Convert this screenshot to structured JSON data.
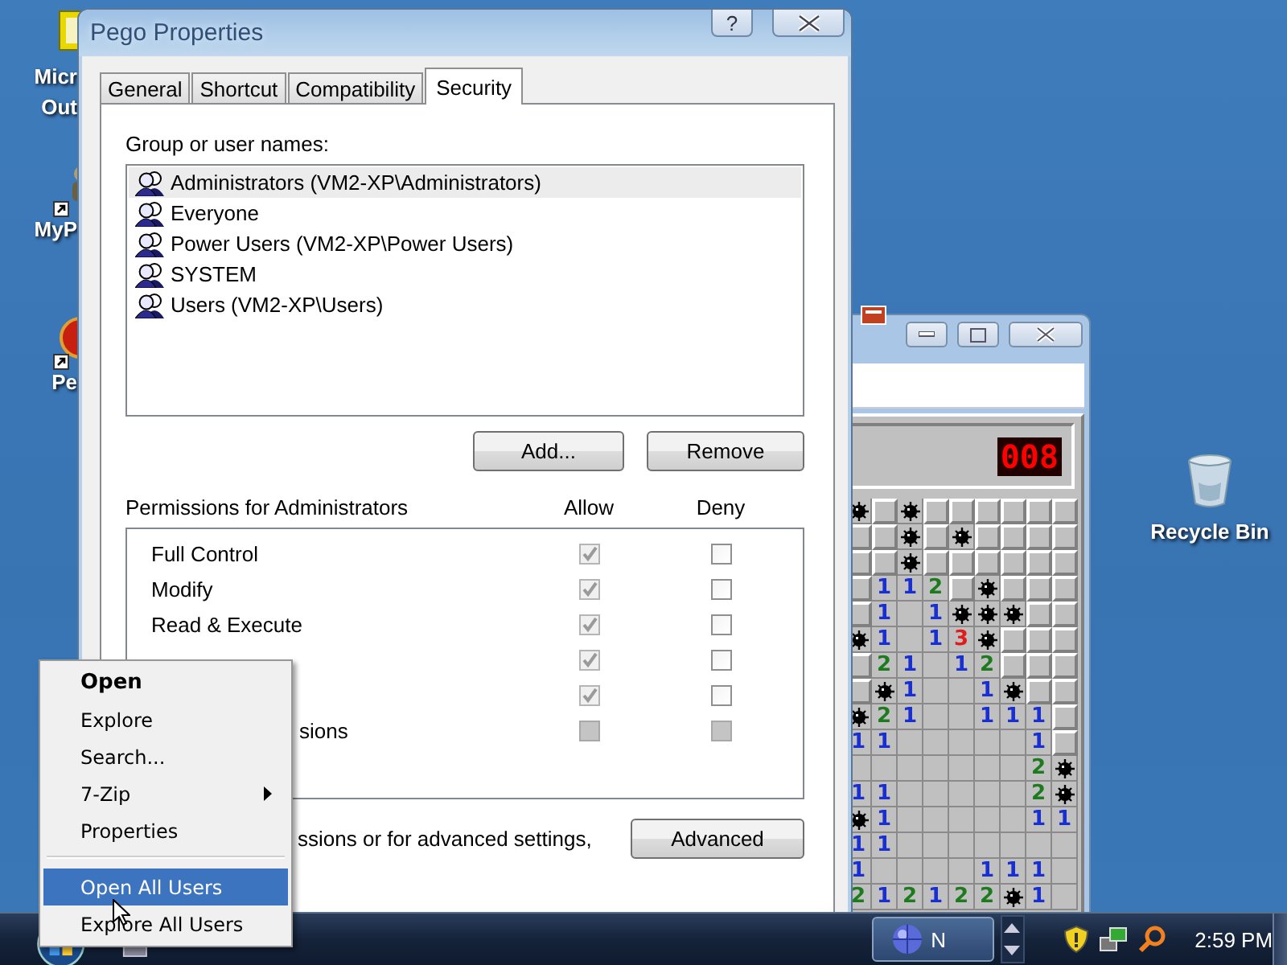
{
  "desktop_icons": [
    {
      "lines": [
        "Micr",
        "Out"
      ],
      "kind": "square",
      "shortcut": false
    },
    {
      "lines": [
        "MyP"
      ],
      "kind": "figure",
      "shortcut": true
    },
    {
      "lines": [
        "Pe"
      ],
      "kind": "ball",
      "shortcut": true
    }
  ],
  "recycle_bin": {
    "label": "Recycle Bin"
  },
  "minesweeper": {
    "counter": "008",
    "rows": [
      [
        {
          "kind": "mine"
        },
        {
          "kind": "hidden"
        },
        {
          "kind": "mine"
        },
        {
          "kind": "hidden"
        },
        {
          "kind": "hidden"
        },
        {
          "kind": "hidden"
        },
        {
          "kind": "hidden"
        },
        {
          "kind": "hidden"
        },
        {
          "kind": "hidden"
        }
      ],
      [
        {
          "kind": "hidden"
        },
        {
          "kind": "hidden"
        },
        {
          "kind": "mine"
        },
        {
          "kind": "hidden"
        },
        {
          "kind": "mine"
        },
        {
          "kind": "hidden"
        },
        {
          "kind": "hidden"
        },
        {
          "kind": "hidden"
        },
        {
          "kind": "hidden"
        }
      ],
      [
        {
          "kind": "hidden"
        },
        {
          "kind": "hidden"
        },
        {
          "kind": "mine"
        },
        {
          "kind": "hidden"
        },
        {
          "kind": "hidden"
        },
        {
          "kind": "hidden"
        },
        {
          "kind": "hidden"
        },
        {
          "kind": "hidden"
        },
        {
          "kind": "hidden"
        }
      ],
      [
        {
          "kind": "hidden"
        },
        {
          "kind": "number",
          "value": "1"
        },
        {
          "kind": "number",
          "value": "1"
        },
        {
          "kind": "number",
          "value": "2"
        },
        {
          "kind": "hidden"
        },
        {
          "kind": "mine"
        },
        {
          "kind": "hidden"
        },
        {
          "kind": "hidden"
        },
        {
          "kind": "hidden"
        }
      ],
      [
        {
          "kind": "hidden"
        },
        {
          "kind": "number",
          "value": "1"
        },
        {
          "kind": "open"
        },
        {
          "kind": "number",
          "value": "1"
        },
        {
          "kind": "mine"
        },
        {
          "kind": "mine"
        },
        {
          "kind": "mine"
        },
        {
          "kind": "hidden"
        },
        {
          "kind": "hidden"
        }
      ],
      [
        {
          "kind": "mine"
        },
        {
          "kind": "number",
          "value": "1"
        },
        {
          "kind": "open"
        },
        {
          "kind": "number",
          "value": "1"
        },
        {
          "kind": "number",
          "value": "3"
        },
        {
          "kind": "mine"
        },
        {
          "kind": "hidden"
        },
        {
          "kind": "hidden"
        },
        {
          "kind": "hidden"
        }
      ],
      [
        {
          "kind": "hidden"
        },
        {
          "kind": "number",
          "value": "2"
        },
        {
          "kind": "number",
          "value": "1"
        },
        {
          "kind": "open"
        },
        {
          "kind": "number",
          "value": "1"
        },
        {
          "kind": "number",
          "value": "2"
        },
        {
          "kind": "hidden"
        },
        {
          "kind": "hidden"
        },
        {
          "kind": "hidden"
        }
      ],
      [
        {
          "kind": "hidden"
        },
        {
          "kind": "mine"
        },
        {
          "kind": "number",
          "value": "1"
        },
        {
          "kind": "open"
        },
        {
          "kind": "open"
        },
        {
          "kind": "number",
          "value": "1"
        },
        {
          "kind": "mine"
        },
        {
          "kind": "hidden"
        },
        {
          "kind": "hidden"
        }
      ],
      [
        {
          "kind": "mine"
        },
        {
          "kind": "number",
          "value": "2"
        },
        {
          "kind": "number",
          "value": "1"
        },
        {
          "kind": "open"
        },
        {
          "kind": "open"
        },
        {
          "kind": "number",
          "value": "1"
        },
        {
          "kind": "number",
          "value": "1"
        },
        {
          "kind": "number",
          "value": "1"
        },
        {
          "kind": "hidden"
        }
      ],
      [
        {
          "kind": "number",
          "value": "1"
        },
        {
          "kind": "number",
          "value": "1"
        },
        {
          "kind": "open"
        },
        {
          "kind": "open"
        },
        {
          "kind": "open"
        },
        {
          "kind": "open"
        },
        {
          "kind": "open"
        },
        {
          "kind": "number",
          "value": "1"
        },
        {
          "kind": "hidden"
        }
      ],
      [
        {
          "kind": "open"
        },
        {
          "kind": "open"
        },
        {
          "kind": "open"
        },
        {
          "kind": "open"
        },
        {
          "kind": "open"
        },
        {
          "kind": "open"
        },
        {
          "kind": "open"
        },
        {
          "kind": "number",
          "value": "2"
        },
        {
          "kind": "mine"
        }
      ],
      [
        {
          "kind": "number",
          "value": "1"
        },
        {
          "kind": "number",
          "value": "1"
        },
        {
          "kind": "open"
        },
        {
          "kind": "open"
        },
        {
          "kind": "open"
        },
        {
          "kind": "open"
        },
        {
          "kind": "open"
        },
        {
          "kind": "number",
          "value": "2"
        },
        {
          "kind": "mine"
        }
      ],
      [
        {
          "kind": "mine"
        },
        {
          "kind": "number",
          "value": "1"
        },
        {
          "kind": "open"
        },
        {
          "kind": "open"
        },
        {
          "kind": "open"
        },
        {
          "kind": "open"
        },
        {
          "kind": "open"
        },
        {
          "kind": "number",
          "value": "1"
        },
        {
          "kind": "number",
          "value": "1"
        }
      ],
      [
        {
          "kind": "number",
          "value": "1"
        },
        {
          "kind": "number",
          "value": "1"
        },
        {
          "kind": "open"
        },
        {
          "kind": "open"
        },
        {
          "kind": "open"
        },
        {
          "kind": "open"
        },
        {
          "kind": "open"
        },
        {
          "kind": "open"
        },
        {
          "kind": "open"
        }
      ],
      [
        {
          "kind": "number",
          "value": "1"
        },
        {
          "kind": "open"
        },
        {
          "kind": "open"
        },
        {
          "kind": "open"
        },
        {
          "kind": "open"
        },
        {
          "kind": "number",
          "value": "1"
        },
        {
          "kind": "number",
          "value": "1"
        },
        {
          "kind": "number",
          "value": "1"
        },
        {
          "kind": "open"
        }
      ],
      [
        {
          "kind": "number",
          "value": "2"
        },
        {
          "kind": "number",
          "value": "1"
        },
        {
          "kind": "number",
          "value": "2"
        },
        {
          "kind": "number",
          "value": "1"
        },
        {
          "kind": "number",
          "value": "2"
        },
        {
          "kind": "number",
          "value": "2"
        },
        {
          "kind": "mine"
        },
        {
          "kind": "number",
          "value": "1"
        },
        {
          "kind": "open"
        }
      ]
    ]
  },
  "dialog": {
    "title": "Pego Properties",
    "help": "?",
    "tabs": [
      {
        "label": "General",
        "selected": false
      },
      {
        "label": "Shortcut",
        "selected": false
      },
      {
        "label": "Compatibility",
        "selected": false
      },
      {
        "label": "Security",
        "selected": true
      }
    ],
    "group_label": "Group or user names:",
    "users": [
      {
        "name": "Administrators (VM2-XP\\Administrators)",
        "selected": true
      },
      {
        "name": "Everyone",
        "selected": false
      },
      {
        "name": "Power Users (VM2-XP\\Power Users)",
        "selected": false
      },
      {
        "name": "SYSTEM",
        "selected": false
      },
      {
        "name": "Users (VM2-XP\\Users)",
        "selected": false
      }
    ],
    "buttons": [
      "Add...",
      "Remove"
    ],
    "permissions_label": "Permissions for Administrators",
    "columns": [
      "Allow",
      "Deny"
    ],
    "permissions": [
      {
        "label": "Full Control",
        "partial": false,
        "allow": {
          "checked": true,
          "disabled": true
        },
        "deny": {
          "checked": false,
          "disabled": false
        }
      },
      {
        "label": "Modify",
        "partial": false,
        "allow": {
          "checked": true,
          "disabled": true
        },
        "deny": {
          "checked": false,
          "disabled": false
        }
      },
      {
        "label": "Read & Execute",
        "partial": false,
        "allow": {
          "checked": true,
          "disabled": true
        },
        "deny": {
          "checked": false,
          "disabled": false
        }
      },
      {
        "allow": {
          "checked": true,
          "disabled": true
        },
        "deny": {
          "checked": false,
          "disabled": false
        }
      },
      {
        "allow": {
          "checked": true,
          "disabled": true
        },
        "deny": {
          "checked": false,
          "disabled": false
        }
      },
      {
        "label": "sions",
        "partial": true,
        "allow": {
          "checked": false,
          "disabled": true
        },
        "deny": {
          "checked": false,
          "disabled": true
        }
      }
    ],
    "note": {
      "text": "ssions or for advanced settings,",
      "partial": true
    },
    "advanced": "Advanced"
  },
  "context_menu": [
    {
      "kind": "item",
      "label": "Open",
      "default": true,
      "submenu": false,
      "selected": false
    },
    {
      "kind": "item",
      "label": "Explore",
      "default": false,
      "submenu": false,
      "selected": false
    },
    {
      "kind": "item",
      "label": "Search...",
      "default": false,
      "submenu": false,
      "selected": false
    },
    {
      "kind": "item",
      "label": "7-Zip",
      "default": false,
      "submenu": true,
      "selected": false
    },
    {
      "kind": "item",
      "label": "Properties",
      "default": false,
      "submenu": false,
      "selected": false
    },
    {
      "kind": "separator"
    },
    {
      "kind": "item",
      "label": "Open All Users",
      "default": false,
      "submenu": false,
      "selected": true
    },
    {
      "kind": "item",
      "label": "Explore All Users",
      "default": false,
      "submenu": false,
      "selected": false
    }
  ],
  "taskbar": {
    "button": "N",
    "clock": "2:59 PM"
  }
}
